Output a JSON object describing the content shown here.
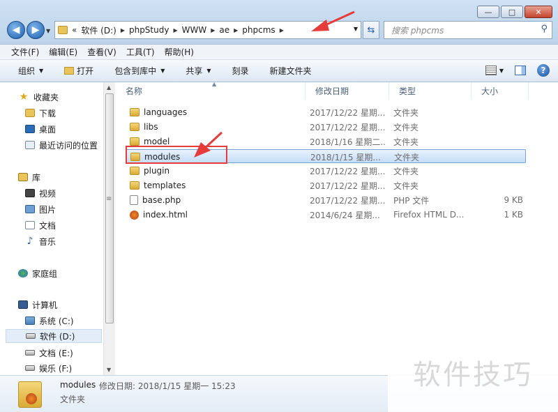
{
  "window": {
    "minimize_glyph": "—",
    "maximize_glyph": "□",
    "close_glyph": "✕"
  },
  "address": {
    "prefix": "«",
    "crumbs": [
      "软件 (D:)",
      "phpStudy",
      "WWW",
      "ae",
      "phpcms"
    ]
  },
  "search": {
    "placeholder": "搜索 phpcms"
  },
  "menu": [
    "文件(F)",
    "编辑(E)",
    "查看(V)",
    "工具(T)",
    "帮助(H)"
  ],
  "toolbar": {
    "organize": "组织",
    "open": "打开",
    "include_in_library": "包含到库中",
    "share": "共享",
    "burn": "刻录",
    "new_folder": "新建文件夹",
    "help": "?"
  },
  "nav": {
    "favorites": "收藏夹",
    "downloads": "下载",
    "desktop": "桌面",
    "recent": "最近访问的位置",
    "libraries": "库",
    "videos": "视频",
    "pictures": "图片",
    "documents": "文档",
    "music": "音乐",
    "homegroup": "家庭组",
    "computer": "计算机",
    "drive_c": "系统 (C:)",
    "drive_d": "软件 (D:)",
    "drive_e": "文档 (E:)",
    "drive_f": "娱乐 (F:)"
  },
  "columns": {
    "name": "名称",
    "date": "修改日期",
    "type": "类型",
    "size": "大小"
  },
  "files": [
    {
      "name": "languages",
      "date": "2017/12/22 星期...",
      "type": "文件夹",
      "size": "",
      "icon": "folder-icon"
    },
    {
      "name": "libs",
      "date": "2017/12/22 星期...",
      "type": "文件夹",
      "size": "",
      "icon": "folder-icon"
    },
    {
      "name": "model",
      "date": "2018/1/16 星期二...",
      "type": "文件夹",
      "size": "",
      "icon": "folder-icon"
    },
    {
      "name": "modules",
      "date": "2018/1/15 星期...",
      "type": "文件夹",
      "size": "",
      "icon": "folder-icon"
    },
    {
      "name": "plugin",
      "date": "2017/12/22 星期...",
      "type": "文件夹",
      "size": "",
      "icon": "folder-icon"
    },
    {
      "name": "templates",
      "date": "2017/12/22 星期...",
      "type": "文件夹",
      "size": "",
      "icon": "folder-icon"
    },
    {
      "name": "base.php",
      "date": "2017/12/22 星期...",
      "type": "PHP 文件",
      "size": "9 KB",
      "icon": "php-file-icon"
    },
    {
      "name": "index.html",
      "date": "2014/6/24 星期...",
      "type": "Firefox HTML D...",
      "size": "1 KB",
      "icon": "firefox-html-icon"
    }
  ],
  "selected_index": 3,
  "details": {
    "name": "modules",
    "meta": "修改日期: 2018/1/15 星期一 15:23",
    "type": "文件夹"
  },
  "watermark": "软件技巧",
  "colors": {
    "annotation_red": "#e53b3b",
    "selection_blue": "#c5ddf7"
  }
}
